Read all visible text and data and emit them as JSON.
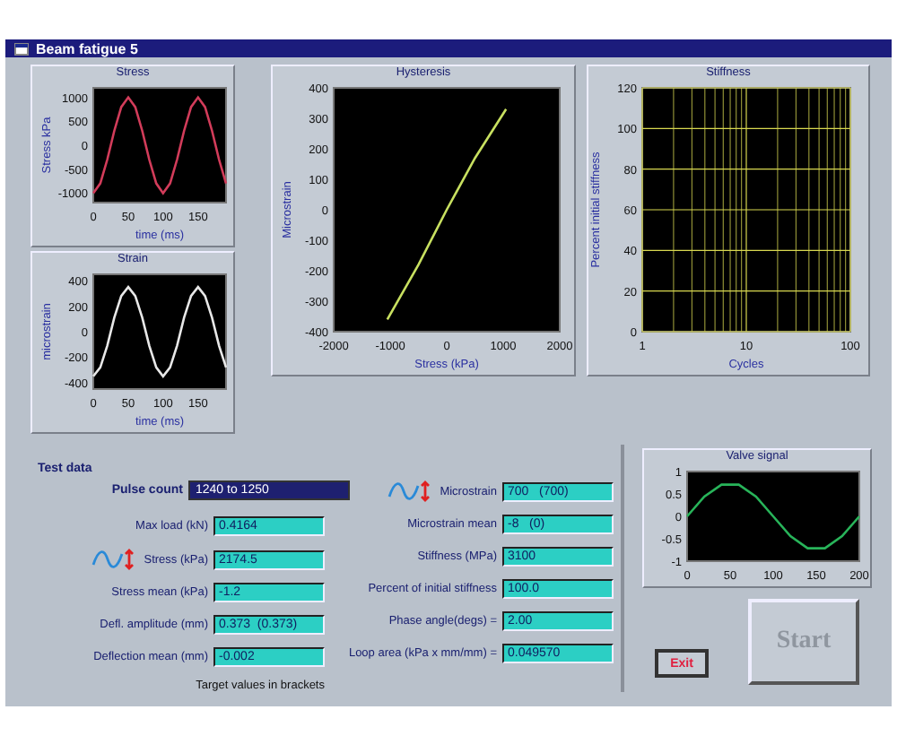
{
  "window": {
    "title": "Beam fatigue 5"
  },
  "charts": {
    "stress": {
      "chart_data": {
        "type": "line",
        "title": "Stress",
        "xlabel": "time (ms)",
        "ylabel": "Stress kPa",
        "xlim": [
          0,
          190
        ],
        "ylim": [
          -1200,
          1200
        ],
        "xticks": [
          0,
          50,
          100,
          150
        ],
        "yticks": [
          -1000,
          -500,
          0,
          500,
          1000
        ],
        "x": [
          0,
          10,
          20,
          30,
          40,
          50,
          60,
          70,
          80,
          90,
          100,
          110,
          120,
          130,
          140,
          150,
          160,
          170,
          180,
          190
        ],
        "series": [
          {
            "color": "#d23c5a",
            "values": [
              -1000,
              -800,
              -300,
              300,
              800,
              1000,
              800,
              300,
              -300,
              -800,
              -1000,
              -800,
              -300,
              300,
              800,
              1000,
              800,
              300,
              -300,
              -800
            ]
          }
        ]
      }
    },
    "strain": {
      "chart_data": {
        "type": "line",
        "title": "Strain",
        "xlabel": "time (ms)",
        "ylabel": "microstrain",
        "xlim": [
          0,
          190
        ],
        "ylim": [
          -450,
          450
        ],
        "xticks": [
          0,
          50,
          100,
          150
        ],
        "yticks": [
          -400,
          -200,
          0,
          200,
          400
        ],
        "x": [
          0,
          10,
          20,
          30,
          40,
          50,
          60,
          70,
          80,
          90,
          100,
          110,
          120,
          130,
          140,
          150,
          160,
          170,
          180,
          190
        ],
        "series": [
          {
            "color": "#e8e8e8",
            "values": [
              -350,
              -280,
              -110,
              110,
              280,
              350,
              280,
              110,
              -110,
              -280,
              -350,
              -280,
              -110,
              110,
              280,
              350,
              280,
              110,
              -110,
              -280
            ]
          }
        ]
      }
    },
    "hysteresis": {
      "chart_data": {
        "type": "line",
        "title": "Hysteresis",
        "xlabel": "Stress (kPa)",
        "ylabel": "Microstrain",
        "xlim": [
          -2000,
          2000
        ],
        "ylim": [
          -400,
          400
        ],
        "xticks": [
          -2000,
          -1000,
          0,
          1000,
          2000
        ],
        "yticks": [
          -400,
          -300,
          -200,
          -100,
          0,
          100,
          200,
          300,
          400
        ],
        "x": [
          -1050,
          -500,
          0,
          500,
          1050
        ],
        "series": [
          {
            "color": "#c8e060",
            "values": [
              -360,
              -180,
              0,
              170,
              330
            ]
          }
        ]
      }
    },
    "stiffness": {
      "chart_data": {
        "type": "line",
        "title": "Stiffness",
        "xlabel": "Cycles",
        "ylabel": "Percent initial stiffness",
        "categories": [
          "1",
          "10",
          "100"
        ],
        "ylim": [
          0,
          120
        ],
        "grid": true,
        "yticks": [
          0,
          20,
          40,
          60,
          80,
          100,
          120
        ]
      }
    },
    "valve": {
      "chart_data": {
        "type": "line",
        "title": "Valve signal",
        "xlim": [
          0,
          200
        ],
        "ylim": [
          -1,
          1
        ],
        "xticks": [
          0,
          50,
          100,
          150,
          200
        ],
        "yticks": [
          -1,
          -0.5,
          0,
          0.5,
          1
        ],
        "x": [
          0,
          20,
          40,
          60,
          80,
          100,
          120,
          140,
          160,
          180,
          200
        ],
        "series": [
          {
            "color": "#28b45a",
            "values": [
              0,
              0.44,
              0.71,
              0.71,
              0.44,
              0,
              -0.44,
              -0.71,
              -0.71,
              -0.44,
              0
            ]
          }
        ]
      }
    }
  },
  "test_data": {
    "title": "Test data",
    "pulse_count": {
      "label": "Pulse count",
      "value": "1240 to 1250"
    },
    "left_fields": [
      {
        "kind": "plain",
        "label": "Max load (kN)",
        "value": "0.4164"
      },
      {
        "kind": "wave",
        "label": "Stress (kPa)",
        "value": "2174.5"
      },
      {
        "kind": "plain",
        "label": "Stress mean (kPa)",
        "value": "-1.2"
      },
      {
        "kind": "plain",
        "label": "Defl. amplitude (mm)",
        "value": "0.373  (0.373)"
      },
      {
        "kind": "plain",
        "label": "Deflection mean (mm)",
        "value": "-0.002"
      }
    ],
    "note": "Target values in brackets",
    "right_fields": [
      {
        "kind": "wave",
        "label": "Microstrain",
        "value": "700   (700)"
      },
      {
        "kind": "plain",
        "label": "Microstrain mean",
        "value": "-8   (0)"
      },
      {
        "kind": "plain",
        "label": "Stiffness (MPa)",
        "value": "3100"
      },
      {
        "kind": "plain",
        "label": "Percent of initial stiffness",
        "value": "100.0"
      },
      {
        "kind": "plain",
        "label": "Phase angle(degs) =",
        "value": "2.00"
      },
      {
        "kind": "plain",
        "label": "Loop area (kPa x mm/mm) =",
        "value": "0.049570"
      }
    ]
  },
  "buttons": {
    "exit": "Exit",
    "start": "Start"
  }
}
